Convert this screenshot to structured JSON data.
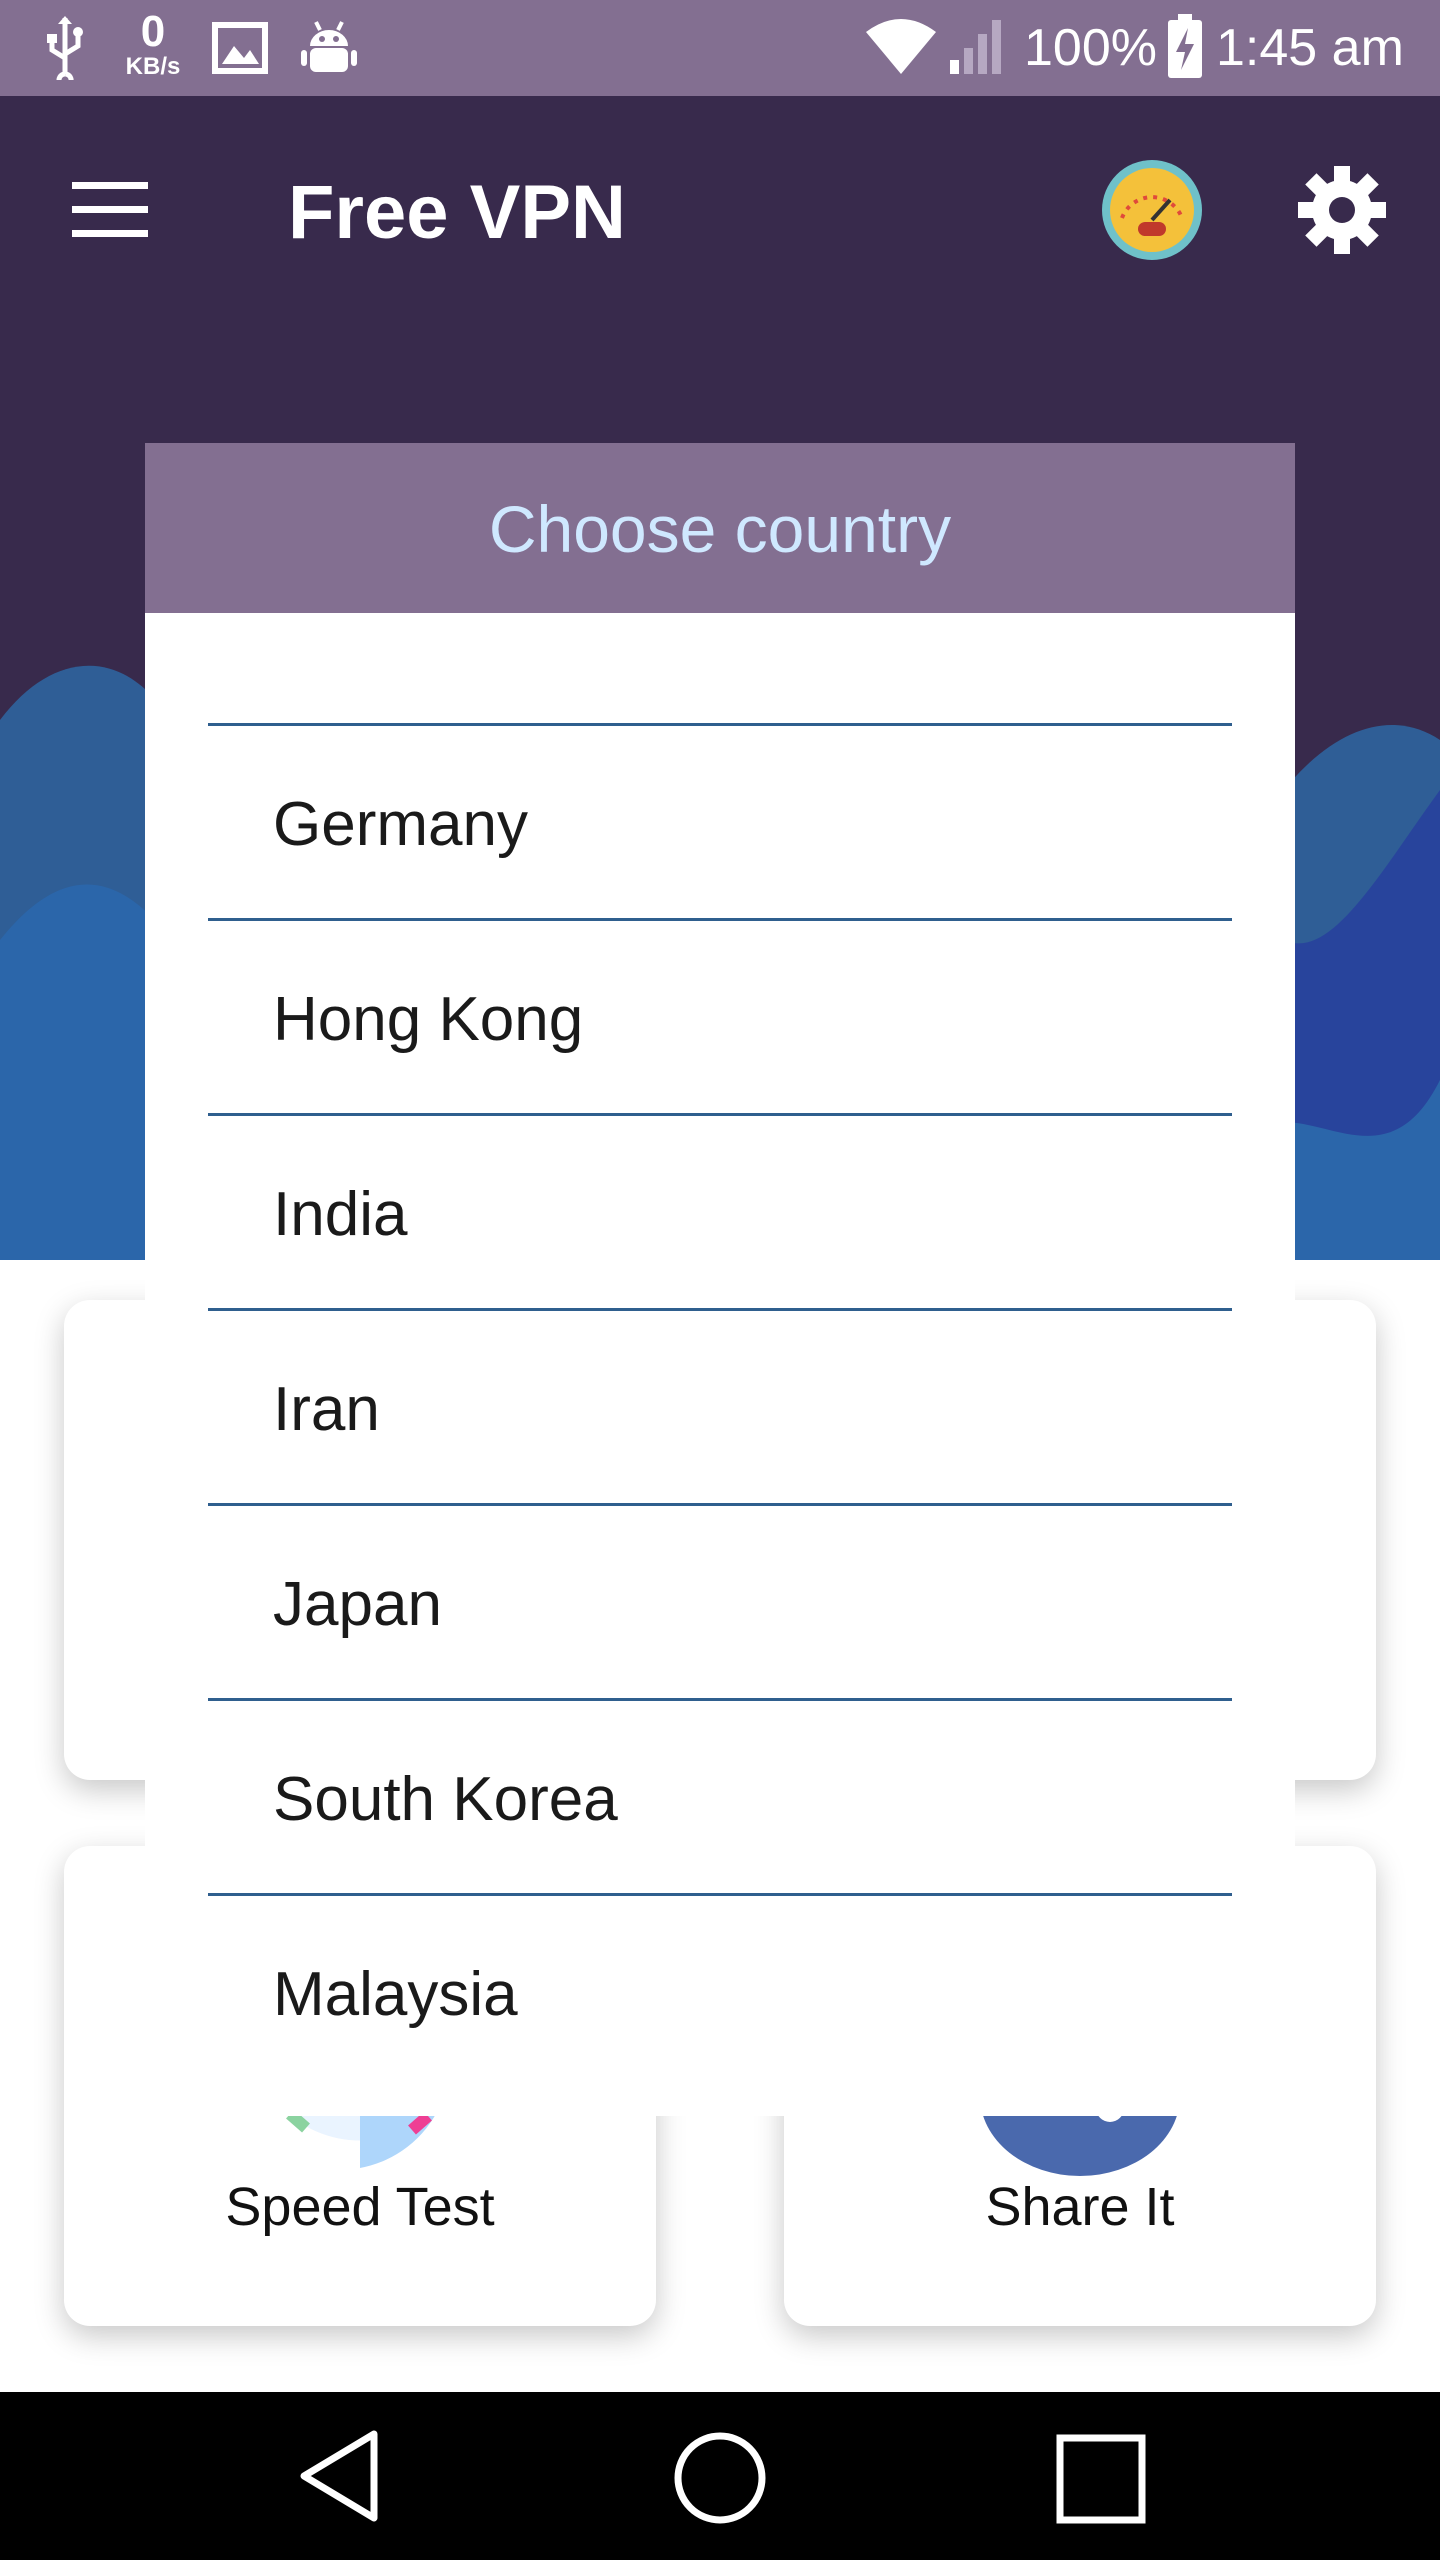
{
  "status_bar": {
    "network_speed_value": "0",
    "network_speed_unit": "KB/s",
    "battery": "100%",
    "time": "1:45 am",
    "icons": [
      "usb-icon",
      "image-icon",
      "android-icon",
      "wifi-icon",
      "signal-icon",
      "battery-charging-icon"
    ]
  },
  "app_bar": {
    "title": "Free VPN",
    "icons": [
      "menu-icon",
      "speedometer-icon",
      "gear-icon"
    ]
  },
  "dialog": {
    "title": "Choose country",
    "countries": [
      {
        "label": "Germany"
      },
      {
        "label": "Hong Kong"
      },
      {
        "label": "India"
      },
      {
        "label": "Iran"
      },
      {
        "label": "Japan"
      },
      {
        "label": "South Korea"
      },
      {
        "label": "Malaysia"
      }
    ]
  },
  "cards": {
    "speed_test_label": "Speed Test",
    "share_it_label": "Share It"
  },
  "colors": {
    "status_bar": "#836f91",
    "app_bar": "#382a4c",
    "dialog_header": "#836f91",
    "dialog_title": "#cfe8ff",
    "divider": "#2f5f8e"
  },
  "nav_bar": {
    "icons": [
      "back-icon",
      "home-icon",
      "recents-icon"
    ]
  }
}
